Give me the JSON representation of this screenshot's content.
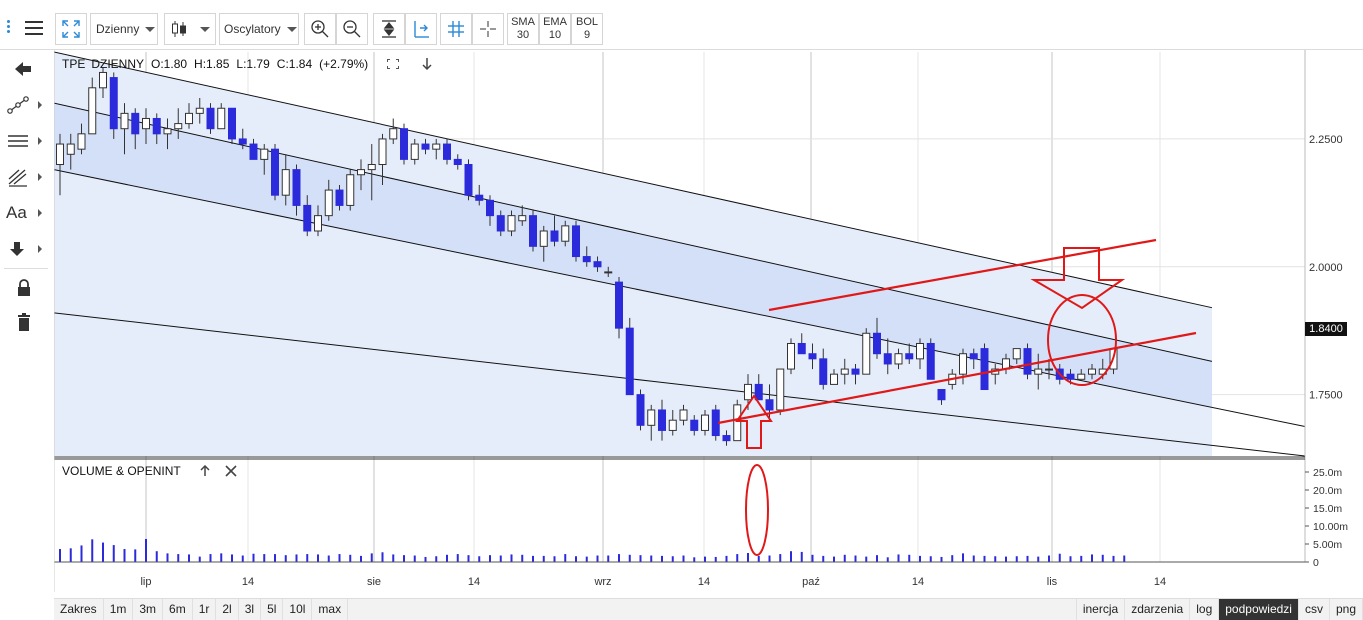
{
  "toolbar": {
    "interval": "Dzienny",
    "oscillators": "Oscylatory",
    "indicators": [
      {
        "name": "SMA",
        "value": "30"
      },
      {
        "name": "EMA",
        "value": "10"
      },
      {
        "name": "BOL",
        "value": "9"
      }
    ]
  },
  "sidebar": {
    "text_tool": "Aa"
  },
  "legend": {
    "symbol": "TPE",
    "interval": "DZIENNY",
    "open": "O:1.80",
    "high": "H:1.85",
    "low": "L:1.79",
    "close": "C:1.84",
    "change": "(+2.79%)"
  },
  "volume_panel": {
    "title": "VOLUME & OPENINT"
  },
  "current_price": "1.8400",
  "bottom": {
    "ranges": [
      "Zakres",
      "1m",
      "3m",
      "6m",
      "1r",
      "2l",
      "3l",
      "5l",
      "10l",
      "max"
    ],
    "options": [
      "inercja",
      "zdarzenia",
      "log",
      "podpowiedzi",
      "csv",
      "png"
    ],
    "active_option": "podpowiedzi"
  },
  "colors": {
    "up": "#ffffff",
    "down": "#2b2bdc",
    "channel": "#dbe5f7",
    "annotation": "#e01818"
  },
  "chart_data": {
    "type": "candlestick",
    "x_ticks": [
      "lip",
      "14",
      "sie",
      "14",
      "wrz",
      "14",
      "paź",
      "14",
      "lis",
      "14"
    ],
    "y_ticks": [
      "2.2500",
      "2.0000",
      "1.7500"
    ],
    "ylim": [
      1.63,
      2.42
    ],
    "volume_ticks": [
      "25.0m",
      "20.0m",
      "15.0m",
      "10.00m",
      "5.00m",
      "0"
    ],
    "volume_ylim": [
      0,
      25
    ],
    "candles": [
      [
        2.2,
        2.26,
        2.14,
        2.24
      ],
      [
        2.22,
        2.26,
        2.19,
        2.24
      ],
      [
        2.23,
        2.28,
        2.22,
        2.26
      ],
      [
        2.26,
        2.37,
        2.26,
        2.35
      ],
      [
        2.35,
        2.39,
        2.33,
        2.38
      ],
      [
        2.37,
        2.38,
        2.25,
        2.27
      ],
      [
        2.27,
        2.32,
        2.22,
        2.3
      ],
      [
        2.3,
        2.31,
        2.23,
        2.26
      ],
      [
        2.27,
        2.31,
        2.24,
        2.29
      ],
      [
        2.29,
        2.3,
        2.24,
        2.26
      ],
      [
        2.26,
        2.29,
        2.23,
        2.27
      ],
      [
        2.27,
        2.31,
        2.25,
        2.28
      ],
      [
        2.28,
        2.32,
        2.27,
        2.3
      ],
      [
        2.3,
        2.33,
        2.28,
        2.31
      ],
      [
        2.31,
        2.32,
        2.26,
        2.27
      ],
      [
        2.27,
        2.32,
        2.27,
        2.31
      ],
      [
        2.31,
        2.31,
        2.24,
        2.25
      ],
      [
        2.25,
        2.27,
        2.23,
        2.24
      ],
      [
        2.24,
        2.25,
        2.21,
        2.21
      ],
      [
        2.21,
        2.24,
        2.18,
        2.23
      ],
      [
        2.23,
        2.24,
        2.13,
        2.14
      ],
      [
        2.14,
        2.22,
        2.12,
        2.19
      ],
      [
        2.19,
        2.2,
        2.1,
        2.12
      ],
      [
        2.12,
        2.14,
        2.06,
        2.07
      ],
      [
        2.07,
        2.12,
        2.06,
        2.1
      ],
      [
        2.1,
        2.17,
        2.09,
        2.15
      ],
      [
        2.15,
        2.16,
        2.11,
        2.12
      ],
      [
        2.12,
        2.19,
        2.11,
        2.18
      ],
      [
        2.18,
        2.21,
        2.15,
        2.19
      ],
      [
        2.19,
        2.24,
        2.13,
        2.2
      ],
      [
        2.2,
        2.26,
        2.16,
        2.25
      ],
      [
        2.25,
        2.29,
        2.24,
        2.27
      ],
      [
        2.27,
        2.28,
        2.2,
        2.21
      ],
      [
        2.21,
        2.25,
        2.2,
        2.24
      ],
      [
        2.24,
        2.25,
        2.22,
        2.23
      ],
      [
        2.23,
        2.25,
        2.21,
        2.24
      ],
      [
        2.24,
        2.25,
        2.2,
        2.21
      ],
      [
        2.21,
        2.22,
        2.19,
        2.2
      ],
      [
        2.2,
        2.21,
        2.13,
        2.14
      ],
      [
        2.14,
        2.16,
        2.12,
        2.13
      ],
      [
        2.13,
        2.14,
        2.08,
        2.1
      ],
      [
        2.1,
        2.11,
        2.06,
        2.07
      ],
      [
        2.07,
        2.11,
        2.06,
        2.1
      ],
      [
        2.09,
        2.12,
        2.08,
        2.1
      ],
      [
        2.1,
        2.11,
        2.03,
        2.04
      ],
      [
        2.04,
        2.08,
        2.01,
        2.07
      ],
      [
        2.07,
        2.1,
        2.04,
        2.05
      ],
      [
        2.05,
        2.09,
        2.04,
        2.08
      ],
      [
        2.08,
        2.09,
        2.01,
        2.02
      ],
      [
        2.02,
        2.04,
        2.0,
        2.01
      ],
      [
        2.01,
        2.02,
        1.99,
        2.0
      ],
      [
        1.99,
        2.0,
        1.98,
        1.99
      ],
      [
        1.97,
        1.98,
        1.86,
        1.88
      ],
      [
        1.88,
        1.9,
        1.75,
        1.75
      ],
      [
        1.75,
        1.76,
        1.68,
        1.69
      ],
      [
        1.69,
        1.73,
        1.66,
        1.72
      ],
      [
        1.72,
        1.74,
        1.66,
        1.68
      ],
      [
        1.68,
        1.72,
        1.67,
        1.7
      ],
      [
        1.7,
        1.73,
        1.69,
        1.72
      ],
      [
        1.7,
        1.71,
        1.67,
        1.68
      ],
      [
        1.68,
        1.72,
        1.67,
        1.71
      ],
      [
        1.72,
        1.73,
        1.66,
        1.67
      ],
      [
        1.67,
        1.68,
        1.65,
        1.66
      ],
      [
        1.66,
        1.74,
        1.66,
        1.73
      ],
      [
        1.74,
        1.79,
        1.72,
        1.77
      ],
      [
        1.77,
        1.79,
        1.74,
        1.74
      ],
      [
        1.74,
        1.77,
        1.7,
        1.72
      ],
      [
        1.72,
        1.8,
        1.71,
        1.8
      ],
      [
        1.8,
        1.86,
        1.79,
        1.85
      ],
      [
        1.85,
        1.87,
        1.83,
        1.83
      ],
      [
        1.83,
        1.85,
        1.8,
        1.82
      ],
      [
        1.82,
        1.84,
        1.76,
        1.77
      ],
      [
        1.77,
        1.8,
        1.77,
        1.79
      ],
      [
        1.79,
        1.82,
        1.77,
        1.8
      ],
      [
        1.8,
        1.81,
        1.77,
        1.79
      ],
      [
        1.79,
        1.88,
        1.79,
        1.87
      ],
      [
        1.87,
        1.9,
        1.82,
        1.83
      ],
      [
        1.83,
        1.86,
        1.79,
        1.81
      ],
      [
        1.81,
        1.84,
        1.8,
        1.83
      ],
      [
        1.83,
        1.85,
        1.81,
        1.82
      ],
      [
        1.82,
        1.86,
        1.8,
        1.85
      ],
      [
        1.85,
        1.86,
        1.78,
        1.78
      ],
      [
        1.76,
        1.76,
        1.73,
        1.74
      ],
      [
        1.77,
        1.8,
        1.76,
        1.79
      ],
      [
        1.79,
        1.84,
        1.77,
        1.83
      ],
      [
        1.83,
        1.84,
        1.8,
        1.82
      ],
      [
        1.84,
        1.85,
        1.76,
        1.76
      ],
      [
        1.79,
        1.81,
        1.77,
        1.8
      ],
      [
        1.8,
        1.83,
        1.79,
        1.82
      ],
      [
        1.82,
        1.84,
        1.81,
        1.84
      ],
      [
        1.84,
        1.85,
        1.78,
        1.79
      ],
      [
        1.79,
        1.83,
        1.76,
        1.8
      ],
      [
        1.8,
        1.82,
        1.78,
        1.8
      ],
      [
        1.8,
        1.81,
        1.77,
        1.78
      ],
      [
        1.79,
        1.8,
        1.77,
        1.78
      ],
      [
        1.78,
        1.8,
        1.78,
        1.79
      ],
      [
        1.79,
        1.81,
        1.78,
        1.8
      ],
      [
        1.79,
        1.82,
        1.78,
        1.8
      ],
      [
        1.8,
        1.84,
        1.79,
        1.84
      ]
    ],
    "volume": [
      3.6,
      3.8,
      4.6,
      6.3,
      5.4,
      4.7,
      3.6,
      3.5,
      6.4,
      3.0,
      2.4,
      2.2,
      2.1,
      1.5,
      2.2,
      2.4,
      2.1,
      1.8,
      2.3,
      2.2,
      2.2,
      1.9,
      2.1,
      2.2,
      2.1,
      1.8,
      2.2,
      2.0,
      1.7,
      2.4,
      2.7,
      2.1,
      1.9,
      1.8,
      1.4,
      1.6,
      2.0,
      2.2,
      1.9,
      1.6,
      1.9,
      1.8,
      2.1,
      2.0,
      1.7,
      1.7,
      1.6,
      2.2,
      1.6,
      1.5,
      1.8,
      1.8,
      2.2,
      2.0,
      1.9,
      1.8,
      1.7,
      1.6,
      1.8,
      1.3,
      1.5,
      1.4,
      1.7,
      2.2,
      2.5,
      1.7,
      1.8,
      2.2,
      3.0,
      2.8,
      2.0,
      1.7,
      1.5,
      2.0,
      1.8,
      1.5,
      1.9,
      1.3,
      2.1,
      2.0,
      1.7,
      1.6,
      1.4,
      1.9,
      2.4,
      1.8,
      1.7,
      1.6,
      1.5,
      1.6,
      1.7,
      1.5,
      1.8,
      2.3,
      1.6,
      1.7,
      2.1,
      2.0,
      1.7,
      1.8
    ]
  }
}
